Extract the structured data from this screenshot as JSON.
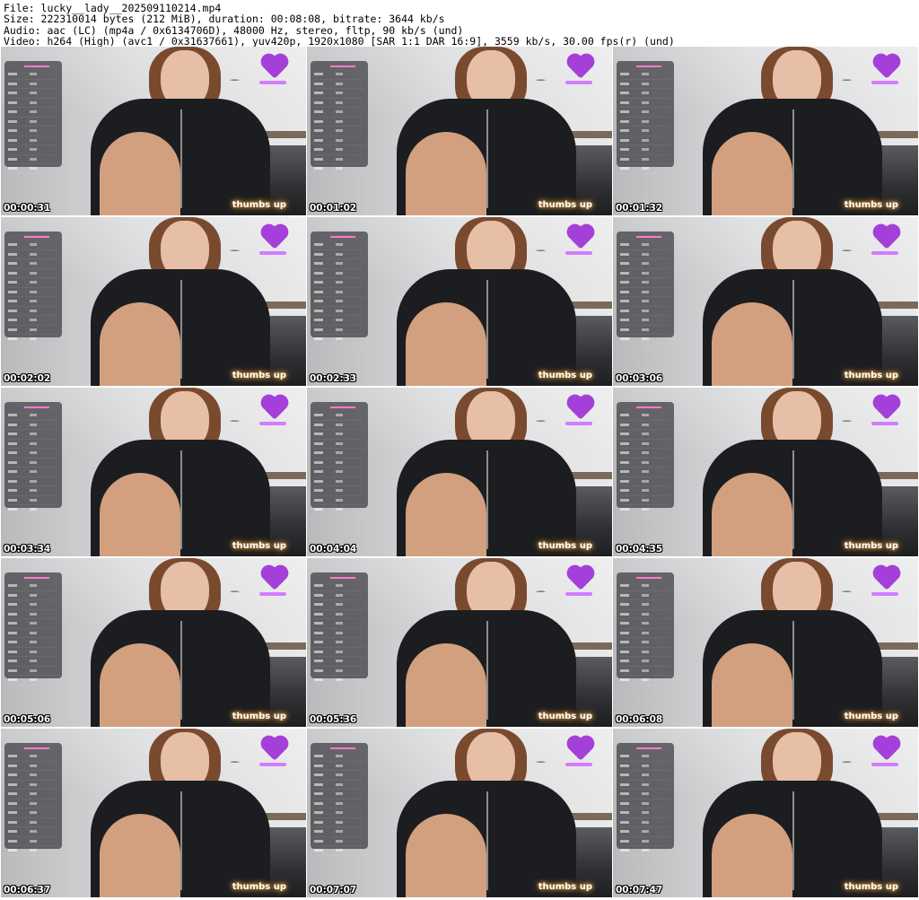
{
  "header": {
    "line1": "File: lucky__lady__202509110214.mp4",
    "line2": "Size: 222310014 bytes (212 MiB), duration: 00:08:08, bitrate: 3644 kb/s",
    "line3": "Audio: aac (LC) (mp4a / 0x6134706D), 48000 Hz, stereo, fltp, 90 kb/s (und)",
    "line4": "Video: h264 (High) (avc1 / 0x31637661), yuv420p, 1920x1080 [SAR 1:1 DAR 16:9], 3559 kb/s, 30.00 fps(r) (und)"
  },
  "overlay": {
    "caption": "thumbs up"
  },
  "thumbnails": [
    {
      "timestamp": "00:00:31"
    },
    {
      "timestamp": "00:01:02"
    },
    {
      "timestamp": "00:01:32"
    },
    {
      "timestamp": "00:02:02"
    },
    {
      "timestamp": "00:02:33"
    },
    {
      "timestamp": "00:03:06"
    },
    {
      "timestamp": "00:03:34"
    },
    {
      "timestamp": "00:04:04"
    },
    {
      "timestamp": "00:04:35"
    },
    {
      "timestamp": "00:05:06"
    },
    {
      "timestamp": "00:05:36"
    },
    {
      "timestamp": "00:06:08"
    },
    {
      "timestamp": "00:06:37"
    },
    {
      "timestamp": "00:07:07"
    },
    {
      "timestamp": "00:07:47"
    }
  ]
}
